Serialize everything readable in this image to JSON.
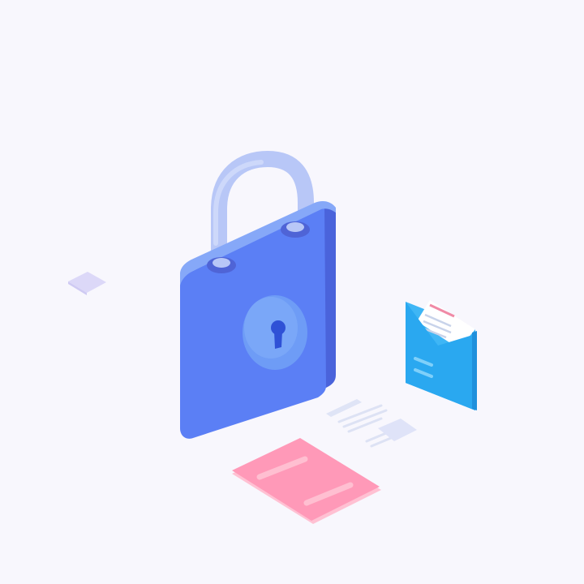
{
  "illustration": {
    "subject": "padlock-security-scene",
    "icons": [
      "padlock-icon",
      "keyhole-icon",
      "envelope-icon",
      "letter-icon",
      "card-icon",
      "text-lines-icon",
      "diamond-icon"
    ],
    "colors": {
      "background": "#f8f7fd",
      "lock_front": "#5b7ff5",
      "lock_side": "#4a63db",
      "lock_top": "#86a8f8",
      "shackle": "#b8c7f7",
      "keyhole_plate": "#6e9cf6",
      "keyhole": "#2f51d6",
      "envelope": "#2aa8f0",
      "card": "#ff99b8",
      "small_diamond": "#dcd8f8"
    }
  }
}
